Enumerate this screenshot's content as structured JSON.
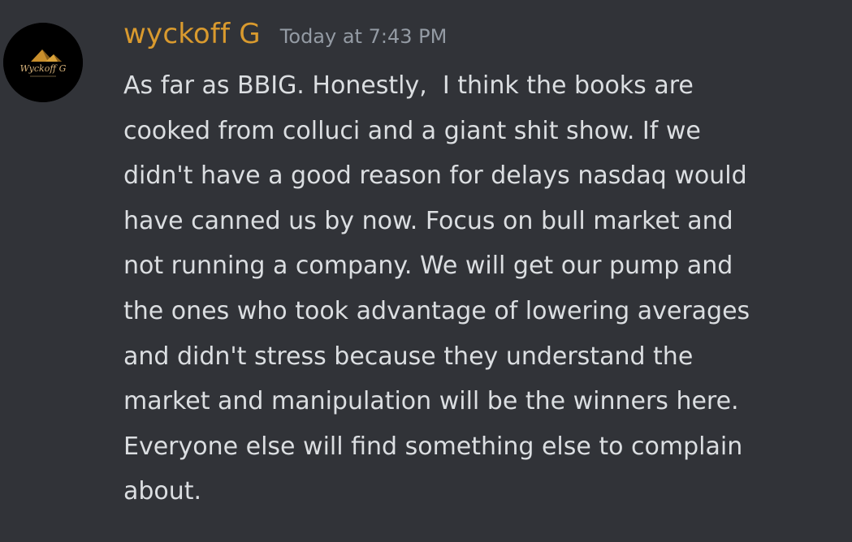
{
  "message": {
    "author": "wyckoff G",
    "timestamp": "Today at 7:43 PM",
    "author_color": "#d99a2e",
    "avatar_text": "Wyckoff G",
    "lines": [
      "As far as BBIG. Honestly,  I think the books are",
      "cooked from colluci and a giant shit show. If we",
      "didn't have a good reason for delays nasdaq would",
      "have canned us by now. Focus on bull market and",
      "not running a company. We will get our pump and",
      "the ones who took advantage of lowering averages",
      "and didn't stress because they understand the",
      "market and manipulation will be the winners here.",
      "Everyone else will find something else to complain",
      "about."
    ]
  }
}
